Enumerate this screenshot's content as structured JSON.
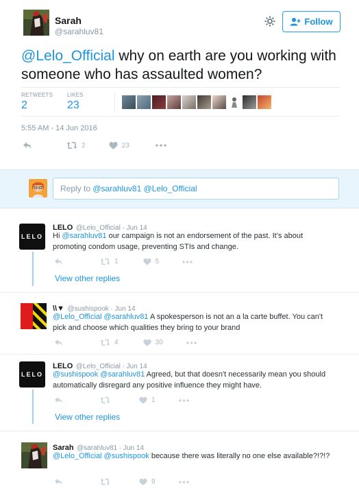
{
  "main_tweet": {
    "name": "Sarah",
    "handle": "@sarahluv81",
    "follow_label": "Follow",
    "text_mention": "@Lelo_Official",
    "text_body": " why on earth are you working with someone who has assaulted women?",
    "retweets_label": "RETWEETS",
    "retweets_value": "2",
    "likes_label": "LIKES",
    "likes_value": "23",
    "timestamp": "5:55 AM - 14 Jun 2016",
    "actions": {
      "retweets": "2",
      "likes": "23"
    }
  },
  "reply_bar": {
    "placeholder_prefix": "Reply to ",
    "placeholder_mentions": "@sarahluv81 @Lelo_Official"
  },
  "colors": {
    "link": "#1b95e0",
    "muted": "#8899a6",
    "thread": "#9bd3ec",
    "reply_bg": "#e8f5fd"
  },
  "replies": [
    {
      "name": "LELO",
      "meta": "@Lelo_Official · Jun 14",
      "avatar_text": "LELO",
      "mention": "@sarahluv81",
      "text_before": "Hi ",
      "text_after": " our campaign is not an endorsement of the past. It’s about promoting condom usage, preventing STIs and change.",
      "retweets": "1",
      "likes": "5",
      "view_other": "View other replies"
    },
    {
      "name": "\\\\▼",
      "meta": "@sushispook · Jun 14",
      "mention": "@Lelo_Official @sarahluv81",
      "text_after": " A spokesperson is not an a la carte buffet. You can't pick and choose which qualities they bring to your brand",
      "retweets": "4",
      "likes": "30"
    },
    {
      "name": "LELO",
      "meta": "@Lelo_Official · Jun 14",
      "avatar_text": "LELO",
      "mention": "@sushispook @sarahluv81",
      "text_after": " Agreed, but that doesn't necessarily mean you should automatically disregard any positive influence they might have.",
      "retweets": "",
      "likes": "1",
      "view_other": "View other replies"
    },
    {
      "name": "Sarah",
      "meta": "@sarahluv81 · Jun 14",
      "mention": "@Lelo_Official @sushispook",
      "text_after": " because there was literally no one else available?!?!?",
      "retweets": "",
      "likes": "9"
    }
  ]
}
